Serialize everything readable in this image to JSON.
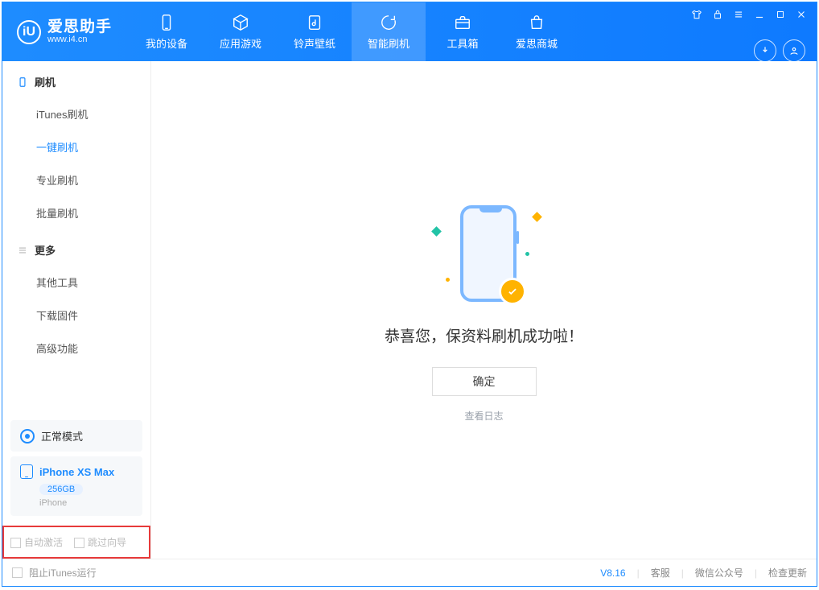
{
  "brand": {
    "name": "爱思助手",
    "url": "www.i4.cn"
  },
  "nav": {
    "my_device": "我的设备",
    "apps_games": "应用游戏",
    "ring_wall": "铃声壁纸",
    "smart_flash": "智能刷机",
    "toolbox": "工具箱",
    "store": "爱思商城"
  },
  "sidebar": {
    "section_flash": "刷机",
    "items_flash": {
      "itunes": "iTunes刷机",
      "oneclick": "一键刷机",
      "pro": "专业刷机",
      "batch": "批量刷机"
    },
    "section_more": "更多",
    "items_more": {
      "other_tools": "其他工具",
      "download_fw": "下载固件",
      "advanced": "高级功能"
    },
    "mode": "正常模式",
    "device_name": "iPhone XS Max",
    "device_capacity": "256GB",
    "device_type": "iPhone",
    "auto_activate": "自动激活",
    "skip_guide": "跳过向导"
  },
  "main": {
    "success": "恭喜您，保资料刷机成功啦！",
    "ok": "确定",
    "view_log": "查看日志"
  },
  "footer": {
    "block_itunes": "阻止iTunes运行",
    "version": "V8.16",
    "support": "客服",
    "wechat": "微信公众号",
    "update": "检查更新"
  }
}
